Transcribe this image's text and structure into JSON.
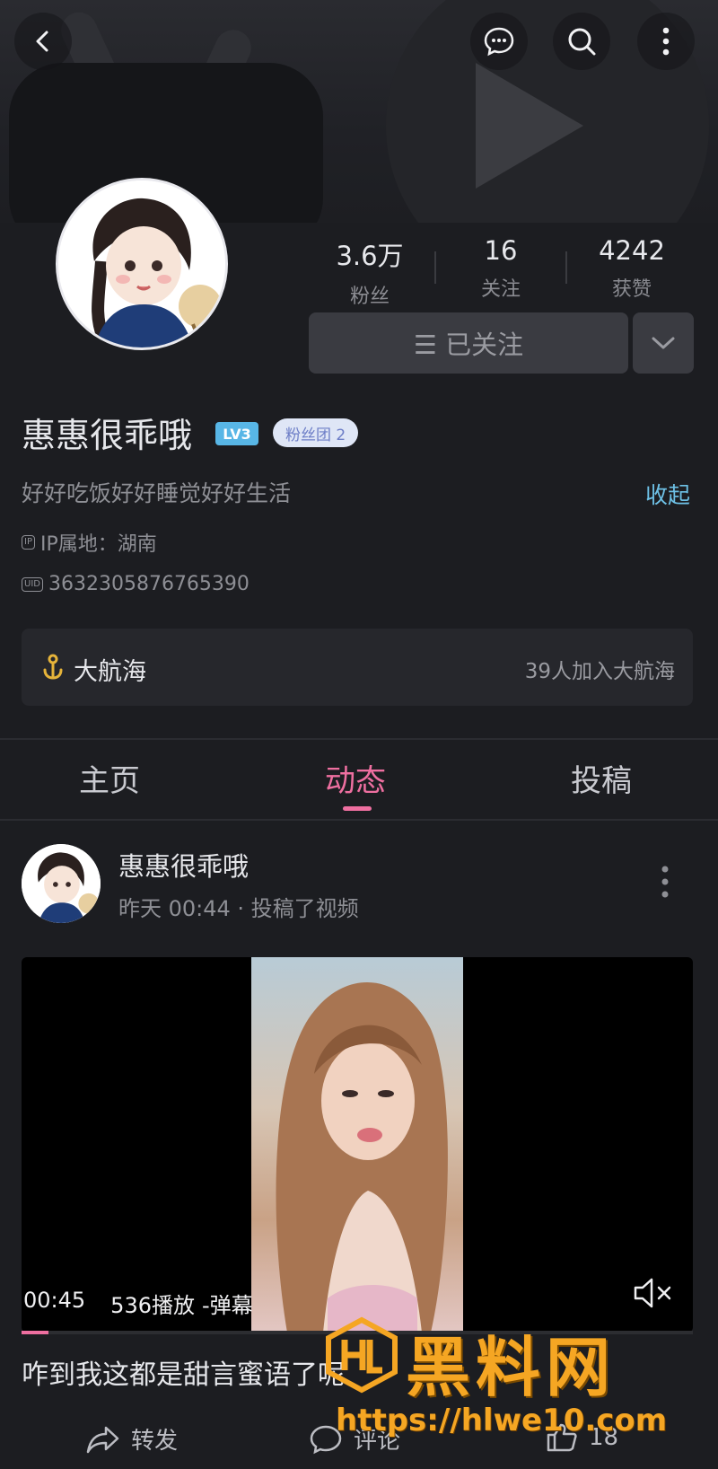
{
  "header": {
    "back_icon": "chevron-left-icon",
    "actions": [
      "chat-bubble-icon",
      "search-icon",
      "more-vertical-icon"
    ]
  },
  "profile": {
    "stats": [
      {
        "value": "3.6万",
        "label": "粉丝"
      },
      {
        "value": "16",
        "label": "关注"
      },
      {
        "value": "4242",
        "label": "获赞"
      }
    ],
    "follow_label": "☰ 已关注",
    "name": "惠惠很乖哦",
    "level": "LV3",
    "fans_group": "粉丝团 2",
    "bio": "好好吃饭好好睡觉好好生活",
    "collapse_label": "收起",
    "ip_location": "IP属地：湖南",
    "uid_tag": "UID",
    "uid": "3632305876765390",
    "voyage_title": "大航海",
    "voyage_count": "39人加入大航海"
  },
  "tabs": [
    {
      "label": "主页",
      "active": false
    },
    {
      "label": "动态",
      "active": true
    },
    {
      "label": "投稿",
      "active": false
    }
  ],
  "post": {
    "author": "惠惠很乖哦",
    "time_text": "昨天 00:44 · 投稿了视频",
    "video": {
      "duration": "00:45",
      "plays": "536播放",
      "danmaku": "-弹幕",
      "progress": 0.04
    },
    "caption": "咋到我这都是甜言蜜语了呢",
    "actions": [
      {
        "icon": "share-icon",
        "label": "转发"
      },
      {
        "icon": "comment-icon",
        "label": "评论"
      },
      {
        "icon": "thumb-up-icon",
        "label": "18"
      }
    ]
  },
  "watermark": {
    "title": "黑料网",
    "url": "https://hlwe10.com"
  },
  "colors": {
    "background": "#1c1d21",
    "accent": "#ee6fa0",
    "link": "#6ec1e6",
    "watermark": "#f5a623"
  }
}
